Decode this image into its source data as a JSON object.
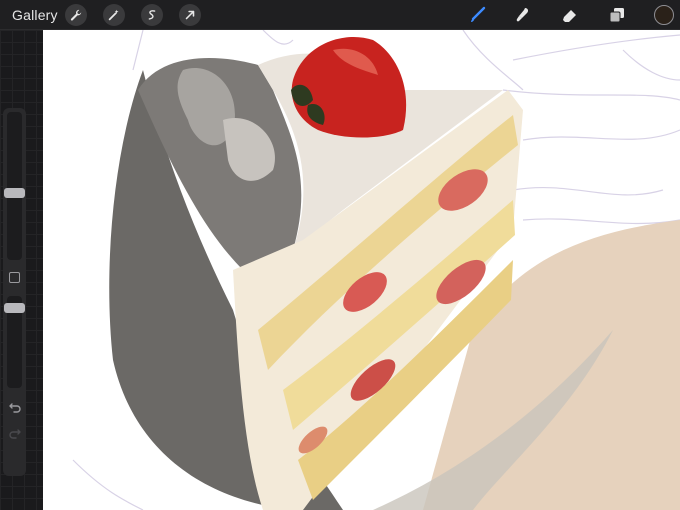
{
  "toolbar": {
    "gallery_label": "Gallery",
    "actions": [
      {
        "name": "wrench-icon"
      },
      {
        "name": "magic-wand-icon"
      },
      {
        "name": "selection-icon"
      },
      {
        "name": "transform-arrow-icon"
      }
    ],
    "tools": [
      {
        "name": "brush-icon",
        "active": true
      },
      {
        "name": "smudge-icon",
        "active": false
      },
      {
        "name": "eraser-icon",
        "active": false
      },
      {
        "name": "layers-icon",
        "active": false
      }
    ],
    "current_color": "#2a2119",
    "active_tool_color": "#3d8bff"
  },
  "sidebar": {
    "brush_size": 0.45,
    "opacity": 0.92
  },
  "canvas": {
    "background": "#ffffff"
  }
}
